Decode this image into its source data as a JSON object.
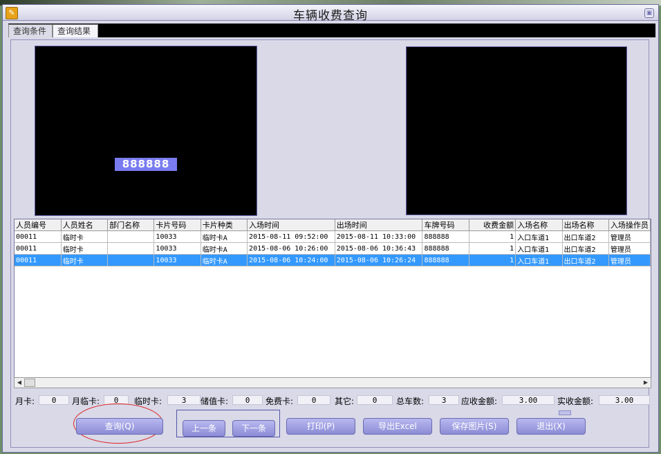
{
  "window": {
    "title": "车辆收费查询"
  },
  "tabs": [
    {
      "label": "查询条件"
    },
    {
      "label": "查询结果"
    }
  ],
  "plate_overlay": "888888",
  "table": {
    "headers": [
      "人员编号",
      "人员姓名",
      "部门名称",
      "卡片号码",
      "卡片种类",
      "入场时间",
      "出场时间",
      "车牌号码",
      "收费金额",
      "入场名称",
      "出场名称",
      "入场操作员"
    ],
    "rows": [
      [
        "00011",
        "临时卡",
        "",
        "10033",
        "临时卡A",
        "2015-08-11 09:52:00",
        "2015-08-11 10:33:00",
        "888888",
        "1",
        "入口车道1",
        "出口车道2",
        "管理员"
      ],
      [
        "00011",
        "临时卡",
        "",
        "10033",
        "临时卡A",
        "2015-08-06 10:26:00",
        "2015-08-06 10:36:43",
        "888888",
        "1",
        "入口车道1",
        "出口车道2",
        "管理员"
      ],
      [
        "00011",
        "临时卡",
        "",
        "10033",
        "临时卡A",
        "2015-08-06 10:24:00",
        "2015-08-06 10:26:24",
        "888888",
        "1",
        "入口车道1",
        "出口车道2",
        "管理员"
      ]
    ],
    "selected_row": 2
  },
  "stats": [
    {
      "label": "月卡:",
      "value": "0"
    },
    {
      "label": "月临卡:",
      "value": "0"
    },
    {
      "label": "临时卡:",
      "value": "3"
    },
    {
      "label": "储值卡:",
      "value": "0"
    },
    {
      "label": "免费卡:",
      "value": "0"
    },
    {
      "label": "其它:",
      "value": "0"
    },
    {
      "label": "总车数:",
      "value": "3"
    },
    {
      "label": "应收金额:",
      "value": "3.00"
    },
    {
      "label": "实收金额:",
      "value": "3.00"
    }
  ],
  "buttons": {
    "query": "查询(Q)",
    "prev": "上一条",
    "next": "下一条",
    "print": "打印(P)",
    "export": "导出Excel",
    "save_image": "保存图片(S)",
    "exit": "退出(X)"
  },
  "colors": {
    "selected_row": "#3399ff",
    "button": "#9c9ce0",
    "plate": "#7b7bf0"
  }
}
